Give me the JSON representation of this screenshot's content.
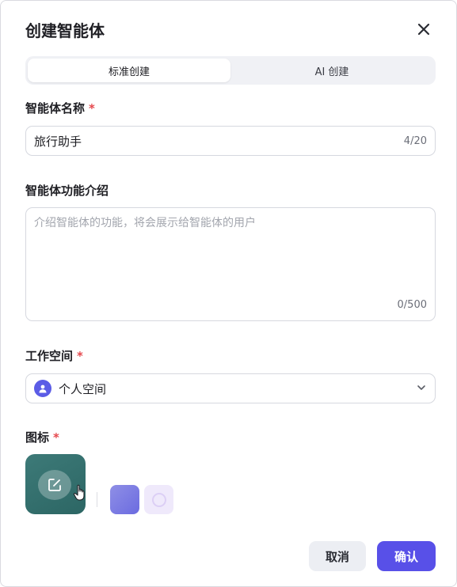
{
  "dialog": {
    "title": "创建智能体"
  },
  "tabs": [
    {
      "label": "标准创建",
      "active": true
    },
    {
      "label": "AI 创建",
      "active": false
    }
  ],
  "fields": {
    "name": {
      "label": "智能体名称",
      "required_mark": "*",
      "value": "旅行助手",
      "counter": "4/20"
    },
    "description": {
      "label": "智能体功能介绍",
      "placeholder": "介绍智能体的功能，将会展示给智能体的用户",
      "counter": "0/500"
    },
    "workspace": {
      "label": "工作空间",
      "required_mark": "*",
      "value": "个人空间",
      "icon": "user-avatar-icon"
    },
    "icon": {
      "label": "图标",
      "required_mark": "*"
    }
  },
  "buttons": {
    "cancel": "取消",
    "confirm": "确认"
  },
  "colors": {
    "accent": "#5850e8",
    "required": "#e5484d",
    "icon_bg": "#35716f"
  }
}
